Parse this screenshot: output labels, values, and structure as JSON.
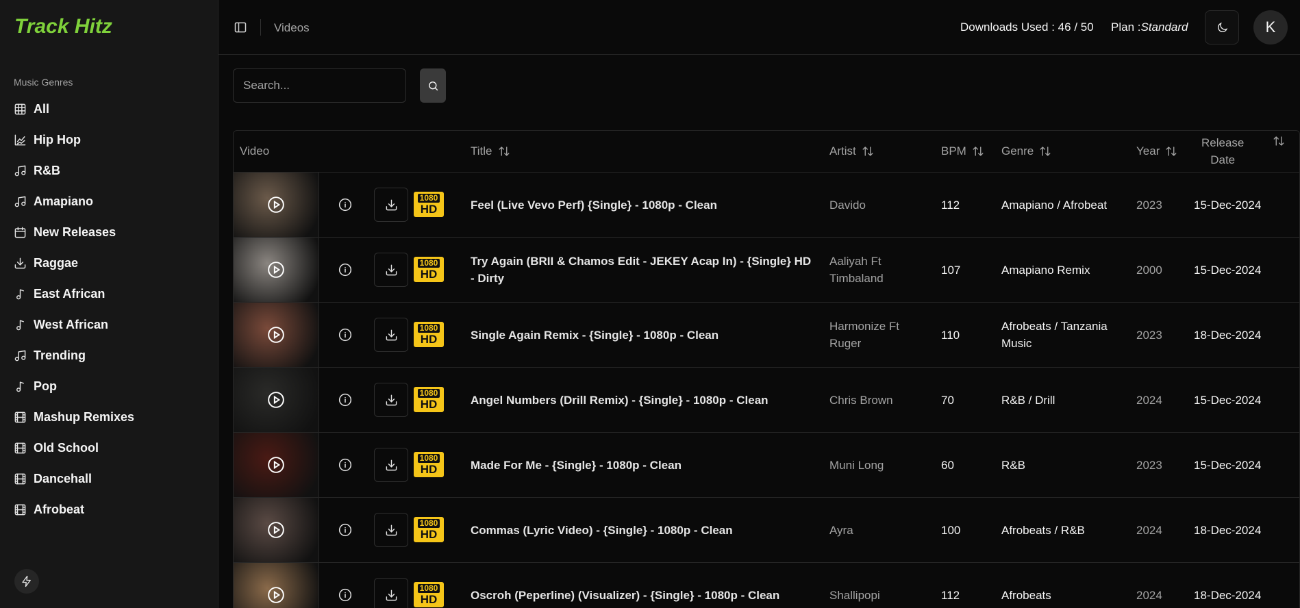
{
  "app": {
    "brand": "Track Hitz",
    "brand_color": "#7fd13b"
  },
  "sidebar": {
    "section_label": "Music Genres",
    "items": [
      {
        "label": "All",
        "icon": "grid-icon"
      },
      {
        "label": "Hip Hop",
        "icon": "chart-icon"
      },
      {
        "label": "R&B",
        "icon": "music-icon"
      },
      {
        "label": "Amapiano",
        "icon": "music-icon"
      },
      {
        "label": "New Releases",
        "icon": "calendar-icon"
      },
      {
        "label": "Raggae",
        "icon": "download-icon"
      },
      {
        "label": "East African",
        "icon": "music-note-icon"
      },
      {
        "label": "West African",
        "icon": "music-note-icon"
      },
      {
        "label": "Trending",
        "icon": "music-icon"
      },
      {
        "label": "Pop",
        "icon": "music-note-icon"
      },
      {
        "label": "Mashup Remixes",
        "icon": "film-icon"
      },
      {
        "label": "Old School",
        "icon": "film-icon"
      },
      {
        "label": "Dancehall",
        "icon": "film-icon"
      },
      {
        "label": "Afrobeat",
        "icon": "film-icon"
      }
    ]
  },
  "header": {
    "breadcrumb": "Videos",
    "downloads_used": "Downloads Used : 46 / 50",
    "plan_label": "Plan :",
    "plan_value": "Standard",
    "avatar_initial": "K"
  },
  "search": {
    "placeholder": "Search..."
  },
  "table": {
    "columns": {
      "video": "Video",
      "title": "Title",
      "artist": "Artist",
      "bpm": "BPM",
      "genre": "Genre",
      "year": "Year",
      "release_line1": "Release",
      "release_line2": "Date"
    },
    "badge": {
      "resolution": "1080",
      "quality": "HD"
    },
    "rows": [
      {
        "title": "Feel (Live Vevo Perf) {Single} - 1080p - Clean",
        "artist": "Davido",
        "bpm": "112",
        "genre": "Amapiano / Afrobeat",
        "year": "2023",
        "release": "15-Dec-2024",
        "thumb_color": "#6b5a4a"
      },
      {
        "title": "Try Again (BRII & Chamos Edit - JEKEY Acap In) - {Single} HD - Dirty",
        "artist": "Aaliyah Ft Timbaland",
        "bpm": "107",
        "genre": "Amapiano Remix",
        "year": "2000",
        "release": "15-Dec-2024",
        "thumb_color": "#8a8580"
      },
      {
        "title": "Single Again Remix - {Single} - 1080p - Clean",
        "artist": "Harmonize Ft Ruger",
        "bpm": "110",
        "genre": "Afrobeats / Tanzania Music",
        "year": "2023",
        "release": "18-Dec-2024",
        "thumb_color": "#7a4a3a"
      },
      {
        "title": "Angel Numbers (Drill Remix) - {Single} - 1080p - Clean",
        "artist": "Chris Brown",
        "bpm": "70",
        "genre": "R&B / Drill",
        "year": "2024",
        "release": "15-Dec-2024",
        "thumb_color": "#2a2a28"
      },
      {
        "title": "Made For Me - {Single} - 1080p - Clean",
        "artist": "Muni Long",
        "bpm": "60",
        "genre": "R&B",
        "year": "2023",
        "release": "15-Dec-2024",
        "thumb_color": "#4a1a14"
      },
      {
        "title": "Commas (Lyric Video) - {Single} - 1080p - Clean",
        "artist": "Ayra",
        "bpm": "100",
        "genre": "Afrobeats / R&B",
        "year": "2024",
        "release": "18-Dec-2024",
        "thumb_color": "#5a4a44"
      },
      {
        "title": "Oscroh (Peperline) (Visualizer) - {Single} - 1080p - Clean",
        "artist": "Shallipopi",
        "bpm": "112",
        "genre": "Afrobeats",
        "year": "2024",
        "release": "18-Dec-2024",
        "thumb_color": "#8a6a4a"
      }
    ]
  }
}
